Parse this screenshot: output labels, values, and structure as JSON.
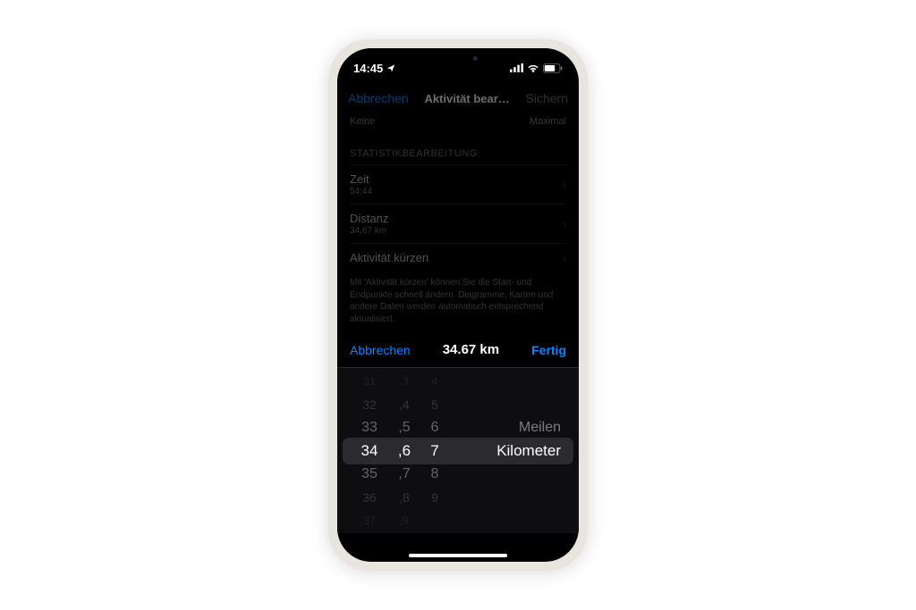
{
  "statusbar": {
    "time": "14:45"
  },
  "navbar": {
    "cancel_label": "Abbrechen",
    "title": "Aktivität bear…",
    "save_label": "Sichern"
  },
  "slider": {
    "min_label": "Keine",
    "max_label": "Maximal"
  },
  "section": {
    "header": "STATISTIKBEARBEITUNG"
  },
  "rows": {
    "time": {
      "label": "Zeit",
      "value": "54:44"
    },
    "distance": {
      "label": "Distanz",
      "value": "34,67 km"
    },
    "trim": {
      "label": "Aktivität kürzen"
    }
  },
  "footer_note": "Mit 'Aktivität kürzen' können Sie die Start- und Endpunkte schnell ändern. Diagramme, Karten und andere Daten werden automatisch entsprechend aktualisiert.",
  "picker": {
    "cancel": "Abbrechen",
    "value": "34.67 km",
    "done": "Fertig",
    "wheel1": [
      "31",
      "32",
      "33",
      "34",
      "35",
      "36",
      "37"
    ],
    "wheel2": [
      ",3",
      ",4",
      ",5",
      ",6",
      ",7",
      ",8",
      ",9"
    ],
    "wheel3": [
      "4",
      "5",
      "6",
      "7",
      "8",
      "9",
      ""
    ],
    "units": [
      "Meilen",
      "Kilometer"
    ],
    "selected_indices": {
      "w1": 3,
      "w2": 3,
      "w3": 3,
      "unit": 1
    }
  }
}
